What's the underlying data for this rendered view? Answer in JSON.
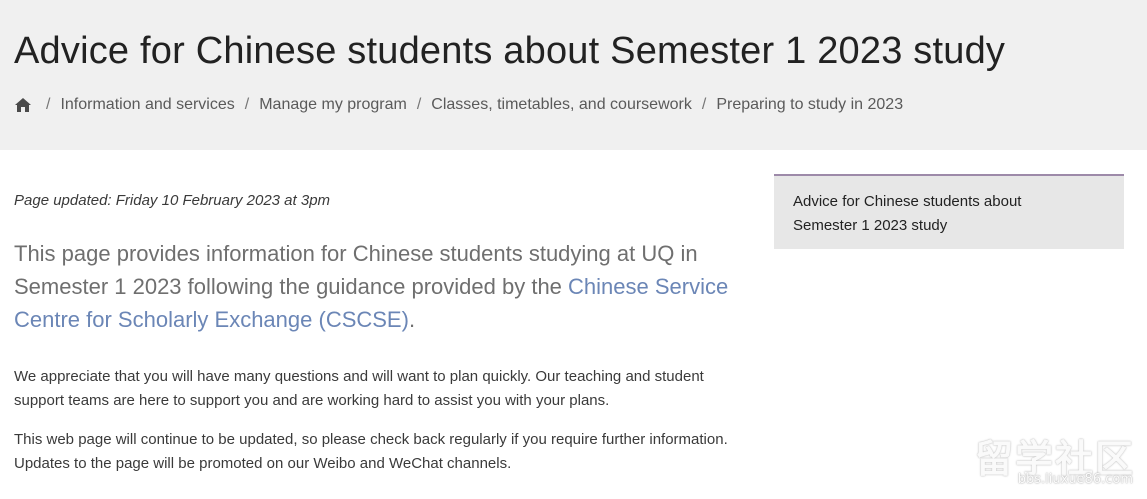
{
  "header": {
    "title": "Advice for Chinese students about Semester 1 2023 study",
    "breadcrumb": {
      "home_icon": "home-icon",
      "separator": "/",
      "items": [
        "Information and services",
        "Manage my program",
        "Classes, timetables, and coursework",
        "Preparing to study in 2023"
      ]
    }
  },
  "main": {
    "updated": "Page updated: Friday 10 February 2023 at 3pm",
    "lead": {
      "before": "This page provides information for Chinese students studying at UQ in Semester 1 2023 following the guidance provided by the ",
      "link": "Chinese Service Centre for Scholarly Exchange (CSCSE)",
      "after": "."
    },
    "paragraphs": [
      "We appreciate that you will have many questions and will want to plan quickly. Our teaching and student support teams are here to support you and are working hard to assist you with your plans.",
      "This web page will continue to be updated, so please check back regularly if you require further information. Updates to the page will be promoted on our Weibo and WeChat channels."
    ]
  },
  "sidebar": {
    "nav_item": "Advice for Chinese students about Semester 1 2023 study"
  },
  "watermark": {
    "chars": "留学社区",
    "url": "bbs.liuxue86.com"
  },
  "colors": {
    "header_bg": "#f0f0f0",
    "link": "#6b86b6",
    "sidebar_bg": "#e7e7e7",
    "sidebar_accent": "#9d8aa9"
  }
}
